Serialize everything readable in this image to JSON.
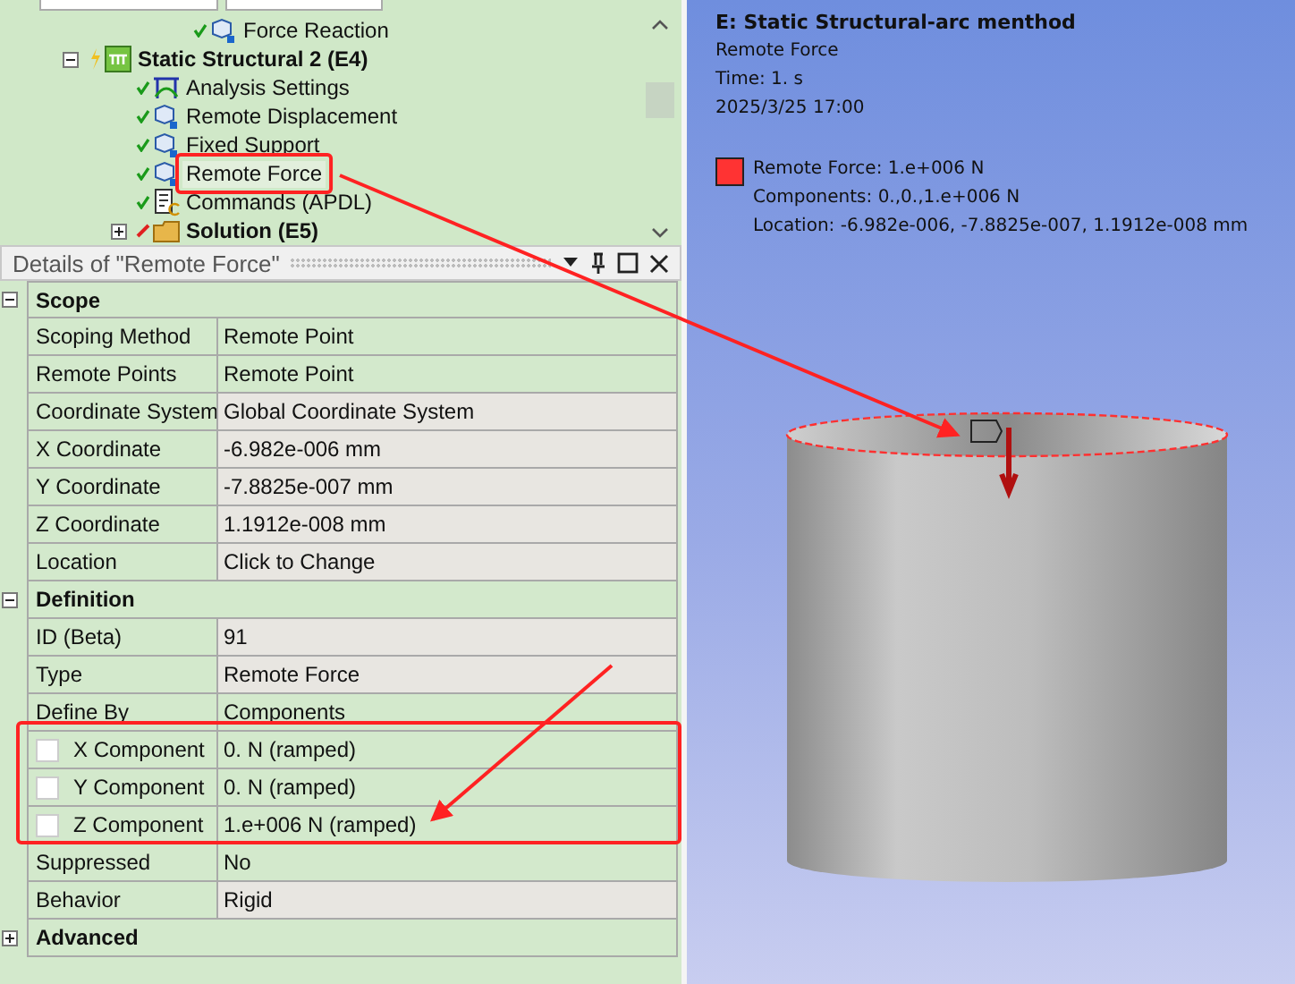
{
  "outline": {
    "continued_items": [
      {
        "label": "Force Reaction",
        "solved": true
      }
    ],
    "items": [
      {
        "label": "Static Structural 2 (E4)",
        "kind": "analysis",
        "expanded": true,
        "children": [
          {
            "label": "Analysis Settings",
            "kind": "settings",
            "solved": true,
            "selected": false
          },
          {
            "label": "Remote Displacement",
            "kind": "load",
            "solved": true,
            "selected": false
          },
          {
            "label": "Fixed Support",
            "kind": "load",
            "solved": true,
            "selected": false
          },
          {
            "label": "Remote Force",
            "kind": "load",
            "solved": true,
            "selected": true
          },
          {
            "label": "Commands (APDL)",
            "kind": "commands",
            "solved": true,
            "selected": false
          },
          {
            "label": "Solution (E5)",
            "kind": "solution",
            "solved": false,
            "selected": false,
            "expanded": false
          }
        ]
      }
    ]
  },
  "details": {
    "title": "Details of \"Remote Force\"",
    "sections": [
      {
        "label": "Scope",
        "expanded": true,
        "rows": [
          {
            "name": "Scoping Method",
            "value": "Remote Point",
            "readonly": false
          },
          {
            "name": "Remote Points",
            "value": "Remote Point",
            "readonly": false
          },
          {
            "name": "Coordinate System",
            "value": "Global Coordinate System",
            "readonly": true
          },
          {
            "name": "X Coordinate",
            "value": "-6.982e-006 mm",
            "readonly": true
          },
          {
            "name": "Y Coordinate",
            "value": "-7.8825e-007 mm",
            "readonly": true
          },
          {
            "name": "Z Coordinate",
            "value": "1.1912e-008 mm",
            "readonly": true
          },
          {
            "name": "Location",
            "value": "Click to Change",
            "readonly": true
          }
        ]
      },
      {
        "label": "Definition",
        "expanded": true,
        "rows": [
          {
            "name": "ID (Beta)",
            "value": "91",
            "readonly": true
          },
          {
            "name": "Type",
            "value": "Remote Force",
            "readonly": true
          },
          {
            "name": "Define By",
            "value": "Components",
            "readonly": false
          },
          {
            "name": "X Component",
            "value": "0. N  (ramped)",
            "readonly": false,
            "checked": false
          },
          {
            "name": "Y Component",
            "value": "0. N  (ramped)",
            "readonly": false,
            "checked": false
          },
          {
            "name": "Z Component",
            "value": "1.e+006 N  (ramped)",
            "readonly": false,
            "checked": false
          },
          {
            "name": "Suppressed",
            "value": "No",
            "readonly": false
          },
          {
            "name": "Behavior",
            "value": "Rigid",
            "readonly": true
          }
        ]
      },
      {
        "label": "Advanced",
        "expanded": false
      }
    ]
  },
  "viewport": {
    "title": "E: Static Structural-arc menthod",
    "lines": [
      "Remote Force",
      "Time: 1. s",
      "2025/3/25 17:00"
    ],
    "legend": [
      {
        "label": "Remote Force: 1.e+006 N",
        "color": "#ff3333",
        "lines": [
          "Components: 0.,0.,1.e+006 N",
          "Location: -6.982e-006, -7.8825e-007, 1.1912e-008 mm"
        ]
      }
    ]
  }
}
